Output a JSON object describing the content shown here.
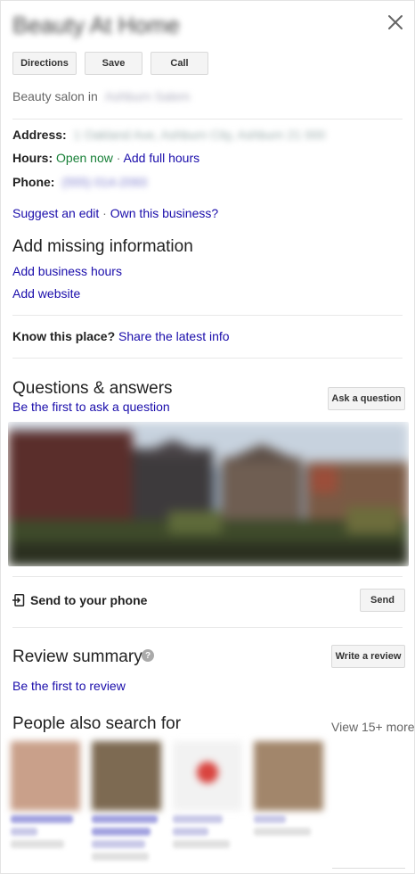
{
  "header": {
    "title": "Beauty At Home"
  },
  "actions": {
    "directions": "Directions",
    "save": "Save",
    "call": "Call"
  },
  "category": {
    "prefix": "Beauty salon in",
    "location": "Ashburn Salem"
  },
  "details": {
    "address_label": "Address:",
    "address_value": "1 Oakland Ave, Ashburn City, Ashburn 21 000",
    "hours_label": "Hours:",
    "hours_status": "Open now",
    "hours_sep": " · ",
    "hours_link": "Add full hours",
    "phone_label": "Phone:",
    "phone_value": "(555) 014-2093"
  },
  "edit_links": {
    "suggest": "Suggest an edit",
    "sep": " · ",
    "own": "Own this business?"
  },
  "missing": {
    "heading": "Add missing information",
    "hours_link": "Add business hours",
    "website_link": "Add website"
  },
  "know": {
    "question": "Know this place?",
    "link": "Share the latest info"
  },
  "qa": {
    "heading": "Questions & answers",
    "link": "Be the first to ask a question",
    "button": "Ask a question"
  },
  "send": {
    "label": "Send to your phone",
    "button": "Send"
  },
  "review": {
    "heading": "Review summary",
    "help": "?",
    "link": "Be the first to review",
    "button": "Write a review"
  },
  "also_search": {
    "heading": "People also search for",
    "view_more": "View 15+ more"
  },
  "icons": [
    "close-icon",
    "send-to-phone-icon",
    "help-icon"
  ],
  "colors": {
    "link": "#1a0dab",
    "open_now": "#188038"
  }
}
